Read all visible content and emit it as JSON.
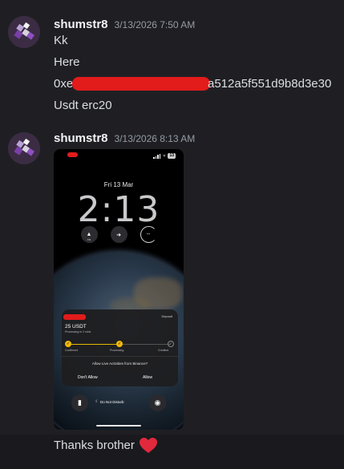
{
  "messages": [
    {
      "author": "shumstr8",
      "timestamp": "3/13/2026 7:50 AM",
      "lines": [
        "Kk",
        "Here",
        "0xe",
        "a512a5f551d9b8d3e30",
        "Usdt erc20"
      ]
    },
    {
      "author": "shumstr8",
      "timestamp": "3/13/2026 8:13 AM",
      "attachment": {
        "date": "Fri 13 Mar",
        "time": "2:13",
        "widget_left_label": "PM",
        "widget_right_label": "--",
        "battery": "13",
        "card": {
          "deposit_label": "Deposit",
          "amount": "25 USDT",
          "status": "Processing in 2 mins",
          "steps": [
            "Confirmed",
            "Processing",
            "Credited"
          ],
          "prompt": "Allow Live Activities from Binance?",
          "deny_label": "Don't Allow",
          "allow_label": "Allow"
        },
        "dnd_label": "Do Not Disturb"
      }
    },
    {
      "text": "Thanks brother",
      "emoji": "heart-icon",
      "emoji_color": "#e0293d"
    }
  ],
  "colors": {
    "background": "#1f1f23",
    "username": "#f2f3f5",
    "timestamp": "#949ba4",
    "redaction": "#e21b1b",
    "binance_yellow": "#f0b90b"
  }
}
